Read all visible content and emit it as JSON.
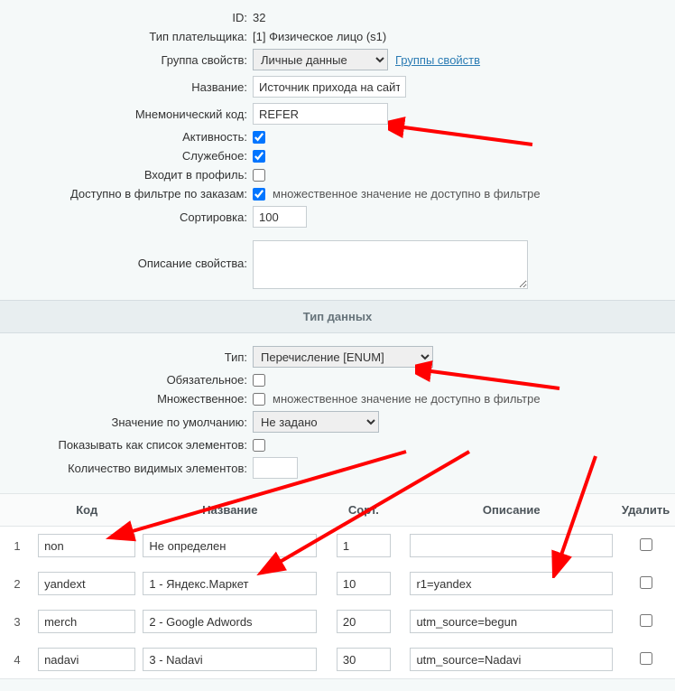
{
  "form": {
    "id_label": "ID:",
    "id_value": "32",
    "payer_type_label": "Тип плательщика:",
    "payer_type_value": "[1] Физическое лицо (s1)",
    "prop_group_label": "Группа свойств:",
    "prop_group_value": "Личные данные",
    "prop_group_link": "Группы свойств",
    "name_label": "Название:",
    "name_value": "Источник прихода на сайт",
    "mnemo_label": "Мнемонический код:",
    "mnemo_value": "REFER",
    "active_label": "Активность:",
    "service_label": "Служебное:",
    "profile_label": "Входит в профиль:",
    "filter_label": "Доступно в фильтре по заказам:",
    "filter_note": "множественное значение не доступно в фильтре",
    "sort_label": "Сортировка:",
    "sort_value": "100",
    "desc_label": "Описание свойства:",
    "desc_value": ""
  },
  "section_type": "Тип данных",
  "type_block": {
    "type_label": "Тип:",
    "type_value": "Перечисление [ENUM]",
    "required_label": "Обязательное:",
    "multi_label": "Множественное:",
    "multi_note": "множественное значение не доступно в фильтре",
    "default_label": "Значение по умолчанию:",
    "default_value": "Не задано",
    "show_list_label": "Показывать как список элементов:",
    "visible_count_label": "Количество видимых элементов:",
    "visible_count_value": ""
  },
  "table": {
    "headers": {
      "code": "Код",
      "name": "Название",
      "sort": "Сорт.",
      "desc": "Описание",
      "del": "Удалить"
    },
    "rows": [
      {
        "idx": "1",
        "code": "non",
        "name": "Не определен",
        "sort": "1",
        "desc": ""
      },
      {
        "idx": "2",
        "code": "yandext",
        "name": "1 - Яндекс.Маркет",
        "sort": "10",
        "desc": "r1=yandex"
      },
      {
        "idx": "3",
        "code": "merch",
        "name": "2 - Google Adwords",
        "sort": "20",
        "desc": "utm_source=begun"
      },
      {
        "idx": "4",
        "code": "nadavi",
        "name": "3 - Nadavi",
        "sort": "30",
        "desc": "utm_source=Nadavi"
      }
    ]
  }
}
